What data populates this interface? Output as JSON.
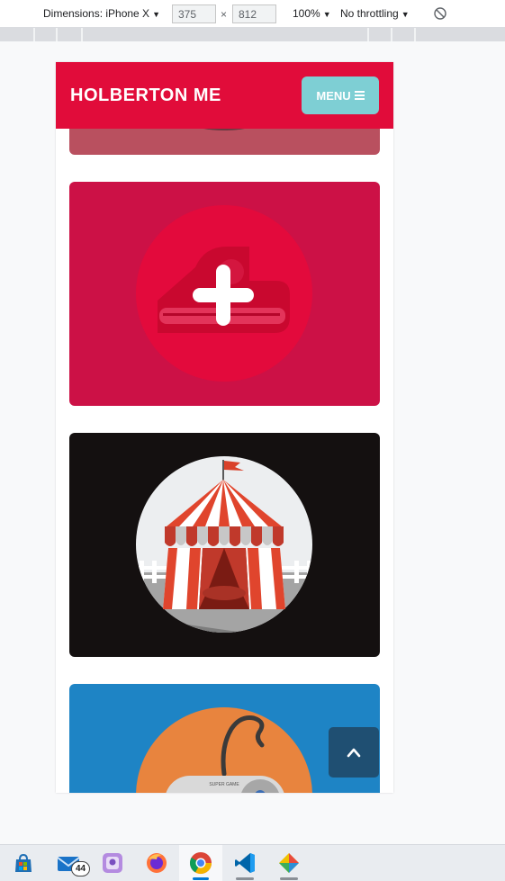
{
  "devtools": {
    "device_label": "Dimensions: iPhone X",
    "width_value": "375",
    "times_symbol": "×",
    "height_value": "812",
    "zoom_label": "100%",
    "throttling_label": "No throttling",
    "rotate_icon": "rotate-icon"
  },
  "site": {
    "brand": "HOLBERTON ME",
    "menu_label": "MENU",
    "colors": {
      "header": "#e10c3a",
      "menu_button": "#7ecfd4",
      "card_red": "#cc1146",
      "card_dark": "#141010",
      "card_blue": "#1e84c5",
      "scroll_top": "#1f4f72"
    },
    "cards": [
      {
        "name": "partial-card",
        "icon": "game-controller-icon"
      },
      {
        "name": "add-card",
        "icon": "plus-icon"
      },
      {
        "name": "circus-card",
        "icon": "circus-tent-icon"
      },
      {
        "name": "snes-card",
        "icon": "snes-controller-icon",
        "controller_text": "SUPER GAME"
      }
    ],
    "scroll_top_icon": "chevron-up-icon"
  },
  "taskbar": {
    "mail_badge": "44",
    "apps": [
      "windows-store-icon",
      "mail-icon",
      "photos-icon",
      "firefox-icon",
      "chrome-icon",
      "vscode-icon",
      "git-icon"
    ]
  }
}
